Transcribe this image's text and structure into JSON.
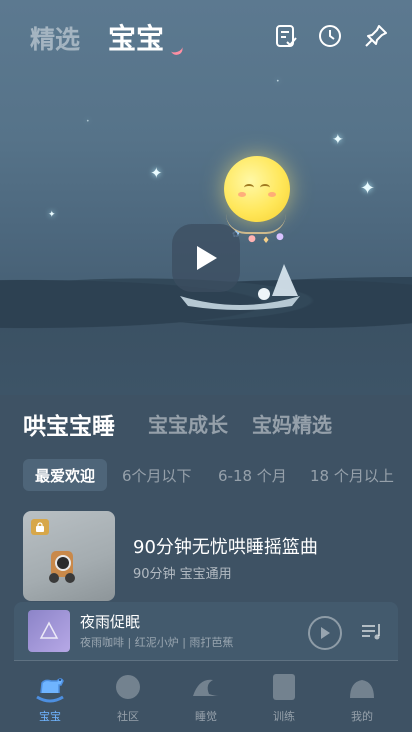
{
  "header": {
    "tab_featured": "精选",
    "tab_baby": "宝宝",
    "icons": [
      "checklist-icon",
      "history-clock-icon",
      "pin-icon"
    ]
  },
  "hero": {
    "play_icon": "play-icon"
  },
  "categories": {
    "items": [
      "哄宝宝睡",
      "宝宝成长",
      "宝妈精选"
    ],
    "active_index": 0
  },
  "age_filters": {
    "items": [
      "最爱欢迎",
      "6个月以下",
      "6-18 个月",
      "18 个月以上"
    ],
    "active_index": 0
  },
  "featured_item": {
    "title": "90分钟无忧哄睡摇篮曲",
    "subtitle": "90分钟 宝宝通用",
    "badge_icon": "lock-icon"
  },
  "mini_player": {
    "title": "夜雨促眠",
    "subtitle": "夜雨咖啡 | 红泥小炉 | 雨打芭蕉"
  },
  "bottom_nav": {
    "items": [
      "宝宝",
      "社区",
      "睡觉",
      "训练",
      "我的"
    ],
    "active_index": 0
  },
  "colors": {
    "accent_blue": "#6fb4ff",
    "background": "#3e5264",
    "moon_yellow": "#ffe75a",
    "tab_underline_pink": "#ff8fa3"
  }
}
